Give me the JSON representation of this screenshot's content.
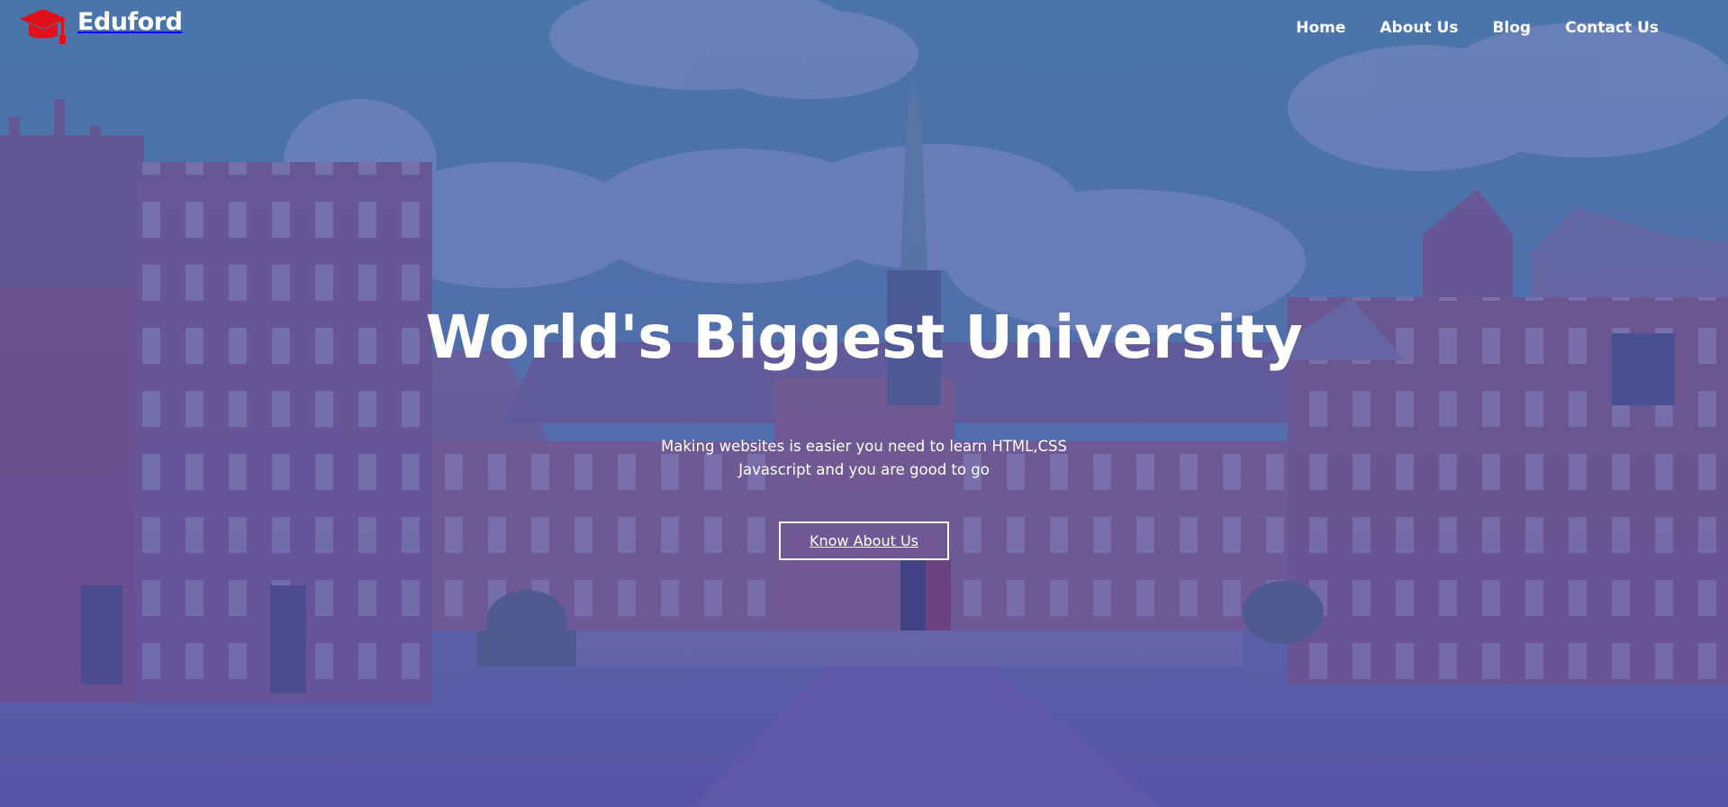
{
  "brand": {
    "name": "Eduford",
    "logo_icon": "graduation-cap-icon",
    "logo_color": "#e0101a"
  },
  "nav": {
    "items": [
      {
        "label": "Home"
      },
      {
        "label": "About Us"
      },
      {
        "label": "Blog"
      },
      {
        "label": "Contact Us"
      }
    ]
  },
  "hero": {
    "title": "World's Biggest University",
    "subtitle_line1": "Making websites is easier you need to learn HTML,CSS",
    "subtitle_line2": "Javascript and you are good to go",
    "cta_label": "Know About Us"
  },
  "colors": {
    "overlay": "#5a5aa8",
    "text": "#ffffff"
  }
}
